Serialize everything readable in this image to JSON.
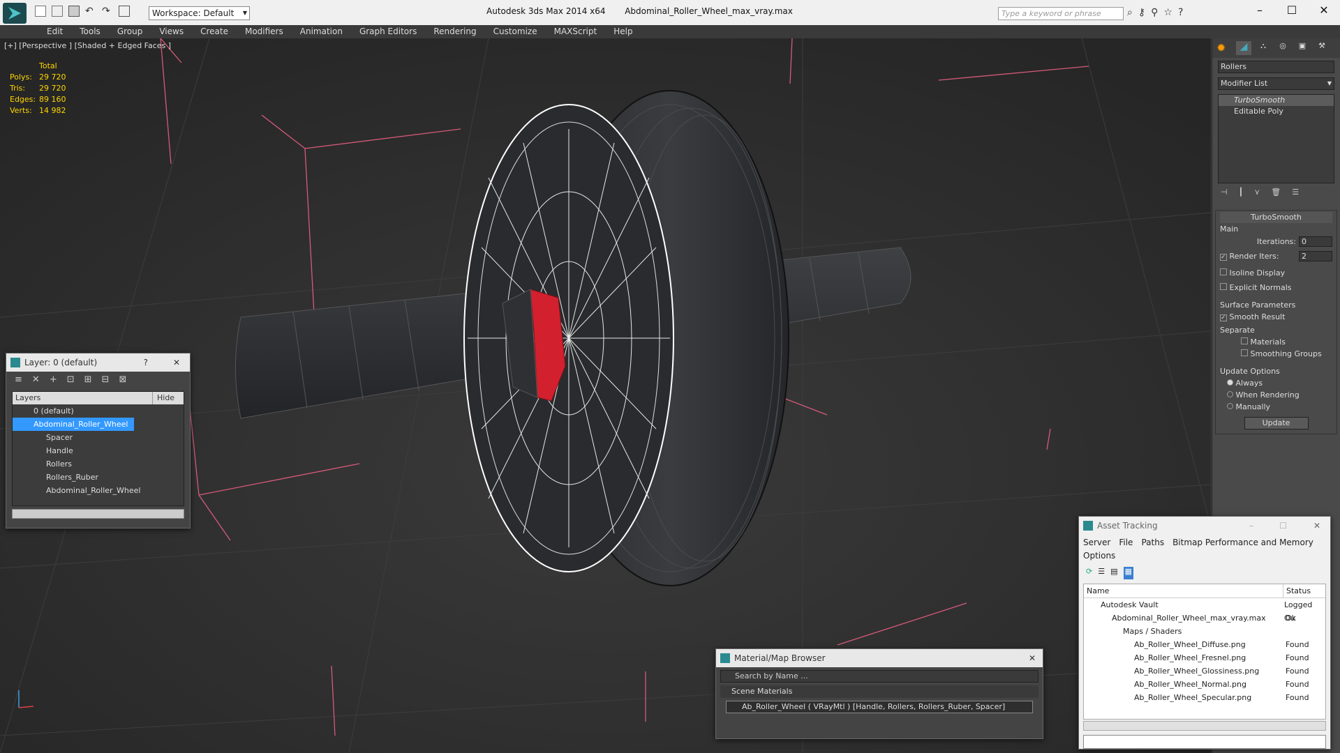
{
  "app": {
    "title": "Autodesk 3ds Max  2014 x64",
    "file": "Abdominal_Roller_Wheel_max_vray.max",
    "workspace": "Workspace: Default",
    "search_placeholder": "Type a keyword or phrase"
  },
  "menu": [
    "Edit",
    "Tools",
    "Group",
    "Views",
    "Create",
    "Modifiers",
    "Animation",
    "Graph Editors",
    "Rendering",
    "Customize",
    "MAXScript",
    "Help"
  ],
  "viewport": {
    "label": "[+] [Perspective ] [Shaded + Edged Faces ]",
    "stats": {
      "header": "Total",
      "rows": [
        {
          "k": "Polys:",
          "v": "29 720"
        },
        {
          "k": "Tris:",
          "v": "29 720"
        },
        {
          "k": "Edges:",
          "v": "89 160"
        },
        {
          "k": "Verts:",
          "v": "14 982"
        }
      ]
    }
  },
  "cmdpanel": {
    "object_name": "Rollers",
    "modifier_list": "Modifier List",
    "stack": [
      "TurboSmooth",
      "Editable Poly"
    ],
    "rollout": "TurboSmooth",
    "main": "Main",
    "iterations_label": "Iterations:",
    "iterations": "0",
    "render_iters_label": "Render Iters:",
    "render_iters": "2",
    "isoline": "Isoline Display",
    "explicit": "Explicit Normals",
    "surface": "Surface Parameters",
    "smooth": "Smooth Result",
    "separate": "Separate",
    "materials": "Materials",
    "smoothing": "Smoothing Groups",
    "update_options": "Update Options",
    "always": "Always",
    "when_rendering": "When Rendering",
    "manually": "Manually",
    "update": "Update"
  },
  "layers": {
    "title": "Layer: 0 (default)",
    "col_layers": "Layers",
    "col_hide": "Hide",
    "rows": [
      {
        "name": "0 (default)",
        "indent": 0
      },
      {
        "name": "Abdominal_Roller_Wheel",
        "indent": 0,
        "selected": true
      },
      {
        "name": "Spacer",
        "indent": 1
      },
      {
        "name": "Handle",
        "indent": 1
      },
      {
        "name": "Rollers",
        "indent": 1
      },
      {
        "name": "Rollers_Ruber",
        "indent": 1
      },
      {
        "name": "Abdominal_Roller_Wheel",
        "indent": 1
      }
    ]
  },
  "material": {
    "title": "Material/Map Browser",
    "search": "Search by Name ...",
    "section": "Scene Materials",
    "item": "Ab_Roller_Wheel  ( VRayMtl ) [Handle, Rollers, Rollers_Ruber, Spacer]"
  },
  "asset": {
    "title": "Asset Tracking",
    "menu": [
      "Server",
      "File",
      "Paths",
      "Bitmap Performance and Memory",
      "Options"
    ],
    "col_name": "Name",
    "col_status": "Status",
    "rows": [
      {
        "name": "Autodesk Vault",
        "status": "Logged Ou",
        "lvl": 0
      },
      {
        "name": "Abdominal_Roller_Wheel_max_vray.max",
        "status": "Ok",
        "lvl": 1
      },
      {
        "name": "Maps / Shaders",
        "status": "",
        "lvl": 2
      },
      {
        "name": "Ab_Roller_Wheel_Diffuse.png",
        "status": "Found",
        "lvl": 3
      },
      {
        "name": "Ab_Roller_Wheel_Fresnel.png",
        "status": "Found",
        "lvl": 3
      },
      {
        "name": "Ab_Roller_Wheel_Glossiness.png",
        "status": "Found",
        "lvl": 3
      },
      {
        "name": "Ab_Roller_Wheel_Normal.png",
        "status": "Found",
        "lvl": 3
      },
      {
        "name": "Ab_Roller_Wheel_Specular.png",
        "status": "Found",
        "lvl": 3
      }
    ]
  }
}
